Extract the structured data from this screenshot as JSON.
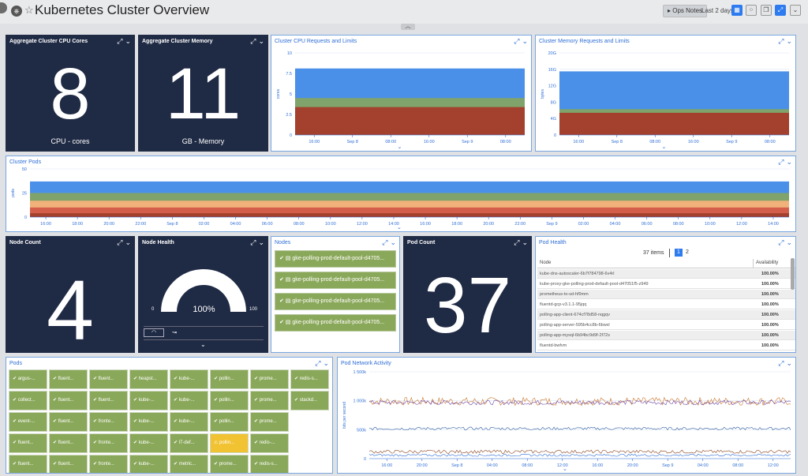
{
  "header": {
    "title": "Kubernetes Cluster Overview",
    "ops_notes": "Ops Notes",
    "time_range": "Last 2 days"
  },
  "widgets": {
    "agg_cpu": {
      "title": "Aggregate Cluster CPU Cores",
      "value": "8",
      "label": "CPU - cores"
    },
    "agg_mem": {
      "title": "Aggregate Cluster Memory",
      "value": "11",
      "label": "GB - Memory"
    },
    "cpu_req": {
      "title": "Cluster CPU Requests and Limits",
      "ylabel": "cores"
    },
    "mem_req": {
      "title": "Cluster Memory Requests and Limits",
      "ylabel": "bytes"
    },
    "pods_chart": {
      "title": "Cluster Pods",
      "ylabel": "pods"
    },
    "node_count": {
      "title": "Node Count",
      "value": "4"
    },
    "node_health": {
      "title": "Node Health",
      "value": "100%",
      "min": "0",
      "max": "100"
    },
    "nodes": {
      "title": "Nodes",
      "items": [
        "gke-polling-prod-default-pool-d4705...",
        "gke-polling-prod-default-pool-d4705...",
        "gke-polling-prod-default-pool-d4705...",
        "gke-polling-prod-default-pool-d4705..."
      ]
    },
    "pod_count": {
      "title": "Pod Count",
      "value": "37"
    },
    "pod_health": {
      "title": "Pod Health",
      "items_label": "37 items",
      "pages": [
        "1",
        "2"
      ],
      "col_node": "Node",
      "col_avail": "Availability",
      "rows": [
        {
          "node": "kube-dns-autoscaler-6b7f784798-6v4rl",
          "avail": "100.00%"
        },
        {
          "node": "kube-proxy-gke-polling-prod-default-pool-d47051f5-z949",
          "avail": "100.00%"
        },
        {
          "node": "prometheus-to-sd-hf9mm",
          "avail": "100.00%"
        },
        {
          "node": "fluentd-gcp-v3.1.1-95jqq",
          "avail": "100.00%"
        },
        {
          "node": "polling-app-client-674cf78d58-nqgqv",
          "avail": "100.00%"
        },
        {
          "node": "polling-app-server-595b4cc8b-6bwxl",
          "avail": "100.00%"
        },
        {
          "node": "polling-app-mysql-6b94bc9d9f-2f72s",
          "avail": "100.00%"
        },
        {
          "node": "fluentd-bwfvm",
          "avail": "100.00%"
        }
      ]
    },
    "pods": {
      "title": "Pods",
      "grid": [
        [
          "argus-...",
          "fluent...",
          "fluent...",
          "heapst...",
          "kube-...",
          "pollin...",
          "prome...",
          "redis-s..."
        ],
        [
          "collect...",
          "fluent...",
          "fluent...",
          "kube-...",
          "kube-...",
          "pollin...",
          "prome...",
          "stackd..."
        ],
        [
          "event-...",
          "fluent...",
          "fronte...",
          "kube-...",
          "kube-...",
          "pollin...",
          "prome...",
          ""
        ],
        [
          "fluent...",
          "fluent...",
          "fronte...",
          "kube-...",
          "l7-def...",
          "pollin...",
          "redis-...",
          ""
        ],
        [
          "fluent...",
          "fluent...",
          "fronte...",
          "kube-...",
          "metric...",
          "prome...",
          "redis-s...",
          ""
        ]
      ],
      "warn_cell": "3-5"
    },
    "net": {
      "title": "Pod Network Activity",
      "ylabel": "bits per second"
    }
  },
  "chart_data": [
    {
      "id": "cpu_req",
      "type": "area",
      "x_ticks": [
        "16:00",
        "Sep 8",
        "08:00",
        "16:00",
        "Sep 9",
        "08:00"
      ],
      "y_ticks": [
        "0",
        "2.5",
        "5",
        "7.5",
        "10"
      ],
      "ylim": [
        0,
        10
      ],
      "series": [
        {
          "value": 8.1,
          "color": "#4a90e8"
        },
        {
          "value": 4.5,
          "color": "#7fa36a"
        },
        {
          "value": 3.4,
          "color": "#a3402e"
        }
      ]
    },
    {
      "id": "mem_req",
      "type": "area",
      "x_ticks": [
        "16:00",
        "Sep 8",
        "08:00",
        "16:00",
        "Sep 9",
        "08:00"
      ],
      "y_ticks": [
        "0",
        "4G",
        "8G",
        "12G",
        "16G",
        "20G"
      ],
      "ylim": [
        0,
        20
      ],
      "series": [
        {
          "value": 15.5,
          "color": "#4a90e8"
        },
        {
          "value": 6.3,
          "color": "#7fa36a"
        },
        {
          "value": 5.4,
          "color": "#a3402e"
        }
      ]
    },
    {
      "id": "pods_chart",
      "type": "area",
      "x_ticks": [
        "16:00",
        "18:00",
        "20:00",
        "22:00",
        "Sep 8",
        "02:00",
        "04:00",
        "06:00",
        "08:00",
        "10:00",
        "12:00",
        "14:00",
        "16:00",
        "18:00",
        "20:00",
        "22:00",
        "Sep 9",
        "02:00",
        "04:00",
        "06:00",
        "08:00",
        "10:00",
        "12:00",
        "14:00"
      ],
      "y_ticks": [
        "0",
        "25",
        "50"
      ],
      "ylim": [
        0,
        50
      ],
      "series": [
        {
          "value": 37,
          "color": "#4a90e8"
        },
        {
          "value": 25,
          "color": "#7fa36a"
        },
        {
          "value": 17,
          "color": "#f0b27a"
        },
        {
          "value": 10,
          "color": "#d35f4b"
        },
        {
          "value": 4,
          "color": "#a3402e"
        }
      ]
    },
    {
      "id": "net",
      "type": "line",
      "x_ticks": [
        "16:00",
        "20:00",
        "Sep 8",
        "04:00",
        "08:00",
        "12:00",
        "16:00",
        "20:00",
        "Sep 9",
        "04:00",
        "08:00",
        "12:00"
      ],
      "y_ticks": [
        "0",
        "500k",
        "1 000k",
        "1 500k"
      ],
      "ylim": [
        0,
        1500
      ],
      "series": [
        {
          "level": 990,
          "noise": 70,
          "color": "#c9752a"
        },
        {
          "level": 970,
          "noise": 40,
          "color": "#6f4aa8"
        },
        {
          "level": 520,
          "noise": 25,
          "color": "#2c5aa0"
        },
        {
          "level": 120,
          "noise": 30,
          "color": "#884422"
        },
        {
          "level": 60,
          "noise": 20,
          "color": "#2f6ed6"
        }
      ]
    }
  ]
}
